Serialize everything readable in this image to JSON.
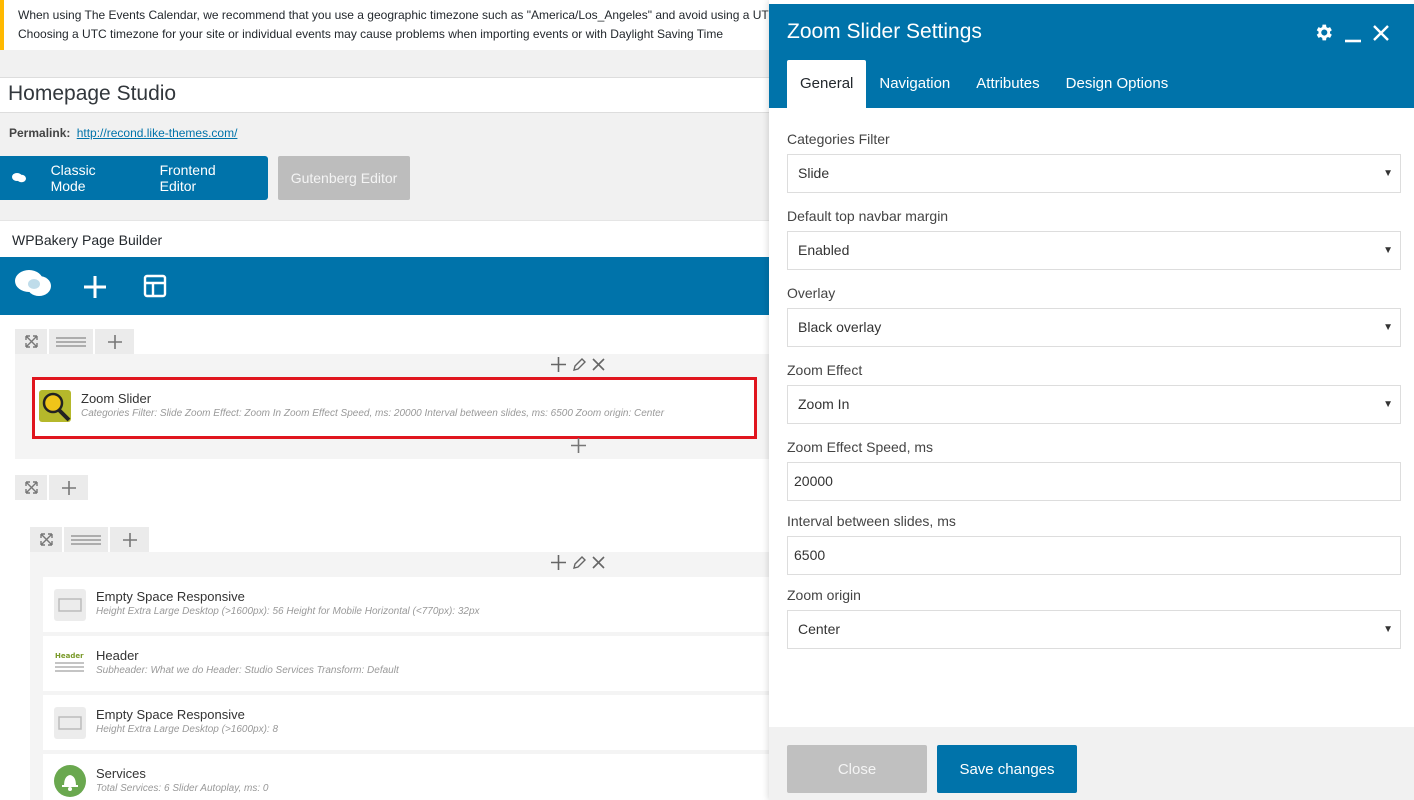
{
  "notice": {
    "line1": "When using The Events Calendar, we recommend that you use a geographic timezone such as \"America/Los_Angeles\" and avoid using a UTC offset",
    "line2": "Choosing a UTC timezone for your site or individual events may cause problems when importing events or with Daylight Saving Time"
  },
  "post": {
    "title": "Homepage Studio",
    "permalink_label": "Permalink:",
    "permalink_url": "http://recond.like-themes.com/"
  },
  "editor_modes": {
    "classic": "Classic Mode",
    "frontend": "Frontend Editor",
    "gutenberg": "Gutenberg Editor"
  },
  "builder": {
    "heading": "WPBakery Page Builder",
    "toolbar_icons": [
      "wpbakery-logo-icon",
      "plus-icon",
      "template-icon"
    ],
    "elements": [
      {
        "title": "Zoom Slider",
        "desc": "Categories Filter: Slide  Zoom Effect: Zoom In  Zoom Effect Speed, ms: 20000  Interval between slides, ms: 6500  Zoom origin: Center",
        "icon": "zoom-slider-icon"
      },
      {
        "title": "Empty Space Responsive",
        "desc": "Height Extra Large Desktop (>1600px): 56  Height for Mobile Horizontal (<770px): 32px",
        "icon": "empty-space-icon"
      },
      {
        "title": "Header",
        "desc": "Subheader: What we do  Header: Studio Services  Transform: Default",
        "icon": "header-icon",
        "icon_text": "Header"
      },
      {
        "title": "Empty Space Responsive",
        "desc": "Height Extra Large Desktop (>1600px): 8",
        "icon": "empty-space-icon"
      },
      {
        "title": "Services",
        "desc": "Total Services: 6  Slider Autoplay, ms: 0",
        "icon": "bell-icon"
      }
    ]
  },
  "panel": {
    "title": "Zoom Slider Settings",
    "icons": [
      "gear-icon",
      "minimize-icon",
      "close-icon"
    ],
    "tabs": [
      "General",
      "Navigation",
      "Attributes",
      "Design Options"
    ],
    "active_tab": "General",
    "fields": [
      {
        "label": "Categories Filter",
        "value": "Slide",
        "type": "select"
      },
      {
        "label": "Default top navbar margin",
        "value": "Enabled",
        "type": "select"
      },
      {
        "label": "Overlay",
        "value": "Black overlay",
        "type": "select"
      },
      {
        "label": "Zoom Effect",
        "value": "Zoom In",
        "type": "select"
      },
      {
        "label": "Zoom Effect Speed, ms",
        "value": "20000",
        "type": "input"
      },
      {
        "label": "Interval between slides, ms",
        "value": "6500",
        "type": "input"
      },
      {
        "label": "Zoom origin",
        "value": "Center",
        "type": "select"
      }
    ],
    "close_label": "Close",
    "save_label": "Save changes"
  },
  "colors": {
    "primary": "#0073aa",
    "highlight": "#e0151e",
    "notice": "#ffb900",
    "services_icon": "#6aa84f"
  }
}
